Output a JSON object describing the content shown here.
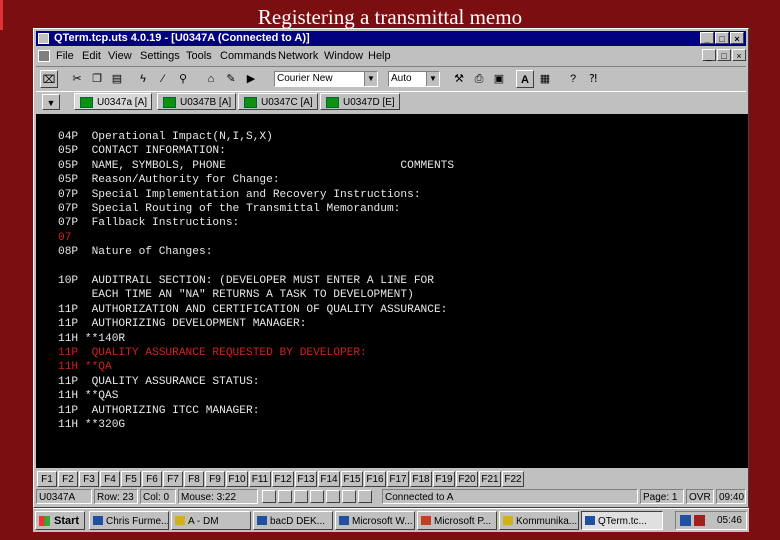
{
  "slide": {
    "title": "Registering a transmittal memo"
  },
  "window": {
    "title": "QTerm.tcp.uts 4.0.19 - [U0347A (Connected to A)]",
    "controls": {
      "minimize": "_",
      "maximize": "□",
      "close": "×"
    }
  },
  "menu": {
    "items": [
      "File",
      "Edit",
      "View",
      "Settings",
      "Tools",
      "Commands",
      "Network",
      "Window",
      "Help"
    ]
  },
  "toolbar": {
    "font_select": "Courier New",
    "size_select": "Auto"
  },
  "tabs": [
    {
      "label": "U0347a [A]"
    },
    {
      "label": "U0347B [A]"
    },
    {
      "label": "U0347C [A]"
    },
    {
      "label": "U0347D [E]"
    }
  ],
  "terminal": {
    "lines": [
      {
        "text": "04P  Operational Impact(N,I,S,X)",
        "color": "#e8e8e8"
      },
      {
        "text": "05P  CONTACT INFORMATION:",
        "color": "#e8e8e8"
      },
      {
        "text": "05P  NAME, SYMBOLS, PHONE                          COMMENTS",
        "color": "#e8e8e8"
      },
      {
        "text": "05P  Reason/Authority for Change:",
        "color": "#e8e8e8"
      },
      {
        "text": "07P  Special Implementation and Recovery Instructions:",
        "color": "#e8e8e8"
      },
      {
        "text": "07P  Special Routing of the Transmittal Memorandum:",
        "color": "#e8e8e8"
      },
      {
        "text": "07P  Fallback Instructions:",
        "color": "#e8e8e8"
      },
      {
        "text": "07",
        "color": "#d02020"
      },
      {
        "text": "08P  Nature of Changes:",
        "color": "#e8e8e8"
      },
      {
        "text": "",
        "color": "#e8e8e8"
      },
      {
        "text": "10P  AUDITRAIL SECTION: (DEVELOPER MUST ENTER A LINE FOR",
        "color": "#e8e8e8"
      },
      {
        "text": "     EACH TIME AN \"NA\" RETURNS A TASK TO DEVELOPMENT)",
        "color": "#e8e8e8"
      },
      {
        "text": "11P  AUTHORIZATION AND CERTIFICATION OF QUALITY ASSURANCE:",
        "color": "#e8e8e8"
      },
      {
        "text": "11P  AUTHORIZING DEVELOPMENT MANAGER:",
        "color": "#e8e8e8"
      },
      {
        "text": "11H **140R",
        "color": "#e8e8e8"
      },
      {
        "text": "11P  QUALITY ASSURANCE REQUESTED BY DEVELOPER:",
        "color": "#d02020"
      },
      {
        "text": "11H **QA",
        "color": "#d02020"
      },
      {
        "text": "11P  QUALITY ASSURANCE STATUS:",
        "color": "#e8e8e8"
      },
      {
        "text": "11H **QAS",
        "color": "#e8e8e8"
      },
      {
        "text": "11P  AUTHORIZING ITCC MANAGER:",
        "color": "#e8e8e8"
      },
      {
        "text": "11H **320G",
        "color": "#e8e8e8"
      }
    ]
  },
  "fkeys": [
    "F1",
    "F2",
    "F3",
    "F4",
    "F5",
    "F6",
    "F7",
    "F8",
    "F9",
    "F10",
    "F11",
    "F12",
    "F13",
    "F14",
    "F15",
    "F16",
    "F17",
    "F18",
    "F19",
    "F20",
    "F21",
    "F22"
  ],
  "status": {
    "session": "U0347A",
    "row": "Row: 23",
    "col": "Col: 0",
    "mouse": "Mouse: 3:22",
    "connection": "Connected to A",
    "page": "Page: 1",
    "ovr": "OVR",
    "time": "09:40"
  },
  "taskbar": {
    "start": "Start",
    "tasks": [
      {
        "label": "Chris Furme..."
      },
      {
        "label": "A - DM"
      },
      {
        "label": "bacD DEK..."
      },
      {
        "label": "Microsoft W..."
      },
      {
        "label": "Microsoft P..."
      },
      {
        "label": "Kommunika..."
      },
      {
        "label": "QTerm.tc..."
      }
    ],
    "clock": "05:46"
  }
}
